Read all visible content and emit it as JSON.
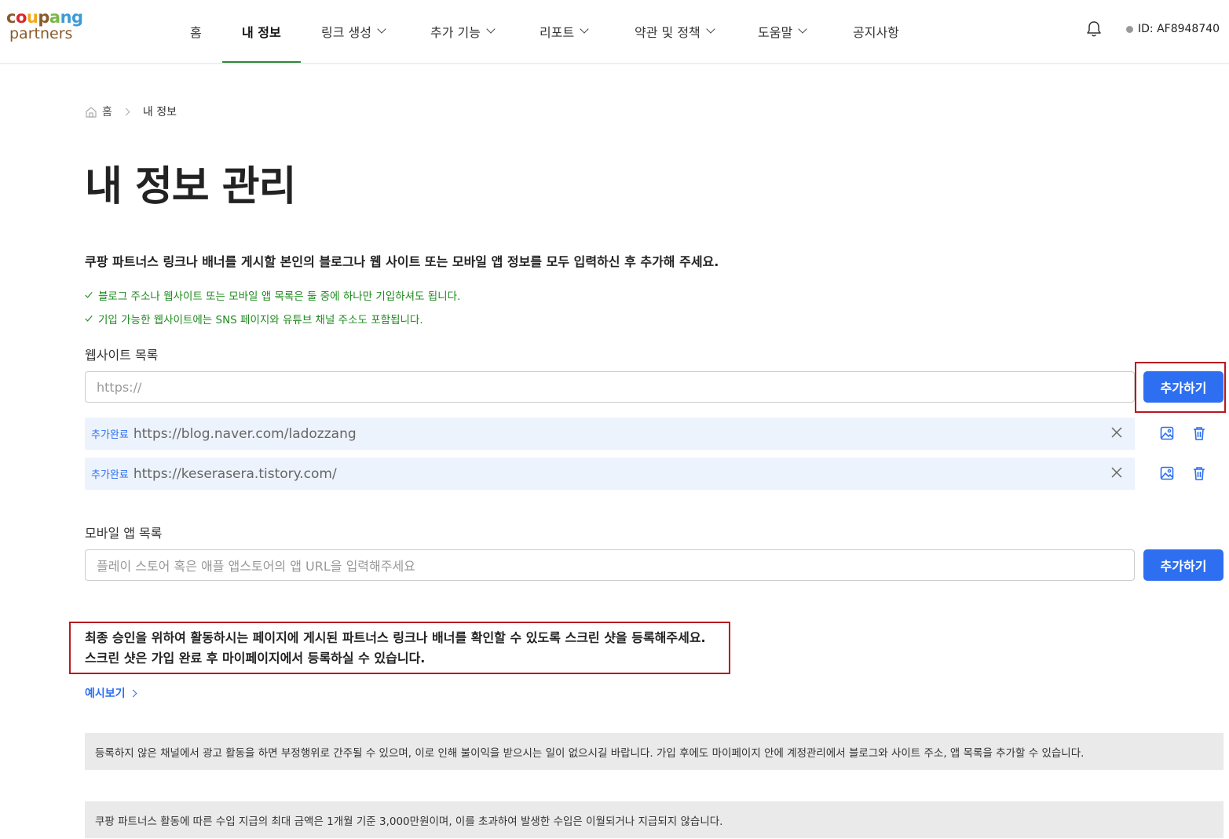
{
  "header": {
    "logo_top": "coupang",
    "logo_bottom": "partners",
    "nav": [
      {
        "label": "홈",
        "dropdown": false
      },
      {
        "label": "내 정보",
        "dropdown": false,
        "active": true
      },
      {
        "label": "링크 생성",
        "dropdown": true
      },
      {
        "label": "추가 기능",
        "dropdown": true
      },
      {
        "label": "리포트",
        "dropdown": true
      },
      {
        "label": "약관 및 정책",
        "dropdown": true
      },
      {
        "label": "도움말",
        "dropdown": true
      },
      {
        "label": "공지사항",
        "dropdown": false
      }
    ],
    "user_id": "ID: AF8948740",
    "brand_color": "#2f8a3b"
  },
  "breadcrumb": {
    "home": "홈",
    "current": "내 정보"
  },
  "page_title": "내 정보 관리",
  "lead_text": "쿠팡 파트너스 링크나 배너를 게시할 본인의 블로그나 웹 사이트 또는 모바일 앱 정보를 모두 입력하신 후 추가해 주세요.",
  "checks": [
    "블로그 주소나 웹사이트 또는 모바일 앱 목록은 둘 중에 하나만 기입하셔도 됩니다.",
    "기입 가능한 웹사이트에는 SNS 페이지와 유튜브 채널 주소도 포함됩니다."
  ],
  "website": {
    "label": "웹사이트 목록",
    "placeholder": "https://",
    "add_label": "추가하기",
    "items": [
      {
        "status": "추가완료",
        "url": "https://blog.naver.com/ladozzang"
      },
      {
        "status": "추가완료",
        "url": "https://keserasera.tistory.com/"
      }
    ]
  },
  "mobile": {
    "label": "모바일 앱 목록",
    "placeholder": "플레이 스토어 혹은 애플 앱스토어의 앱 URL을 입력해주세요",
    "add_label": "추가하기"
  },
  "notice": {
    "line1": "최종 승인을 위하여 활동하시는 페이지에 게시된 파트너스 링크나 배너를 확인할 수 있도록 스크린 샷을 등록해주세요.",
    "line2": "스크린 샷은 가입 완료 후 마이페이지에서 등록하실 수 있습니다."
  },
  "example_link": "예시보기",
  "info_boxes": [
    "등록하지 않은 채널에서 광고 활동을 하면 부정행위로 간주될 수 있으며, 이로 인해 불이익을 받으시는 일이 없으시길 바랍니다. 가입 후에도 마이페이지 안에 계정관리에서 블로그와 사이트 주소, 앱 목록을 추가할 수 있습니다.",
    "쿠팡 파트너스 활동에 따른 수입 지급의 최대 금액은 1개월 기준 3,000만원이며, 이를 초과하여 발생한 수입은 이월되거나 지급되지 않습니다."
  ],
  "colors": {
    "accent": "#2d6ff0",
    "check_green": "#1f8a1f",
    "highlight_red": "#b7191f"
  }
}
